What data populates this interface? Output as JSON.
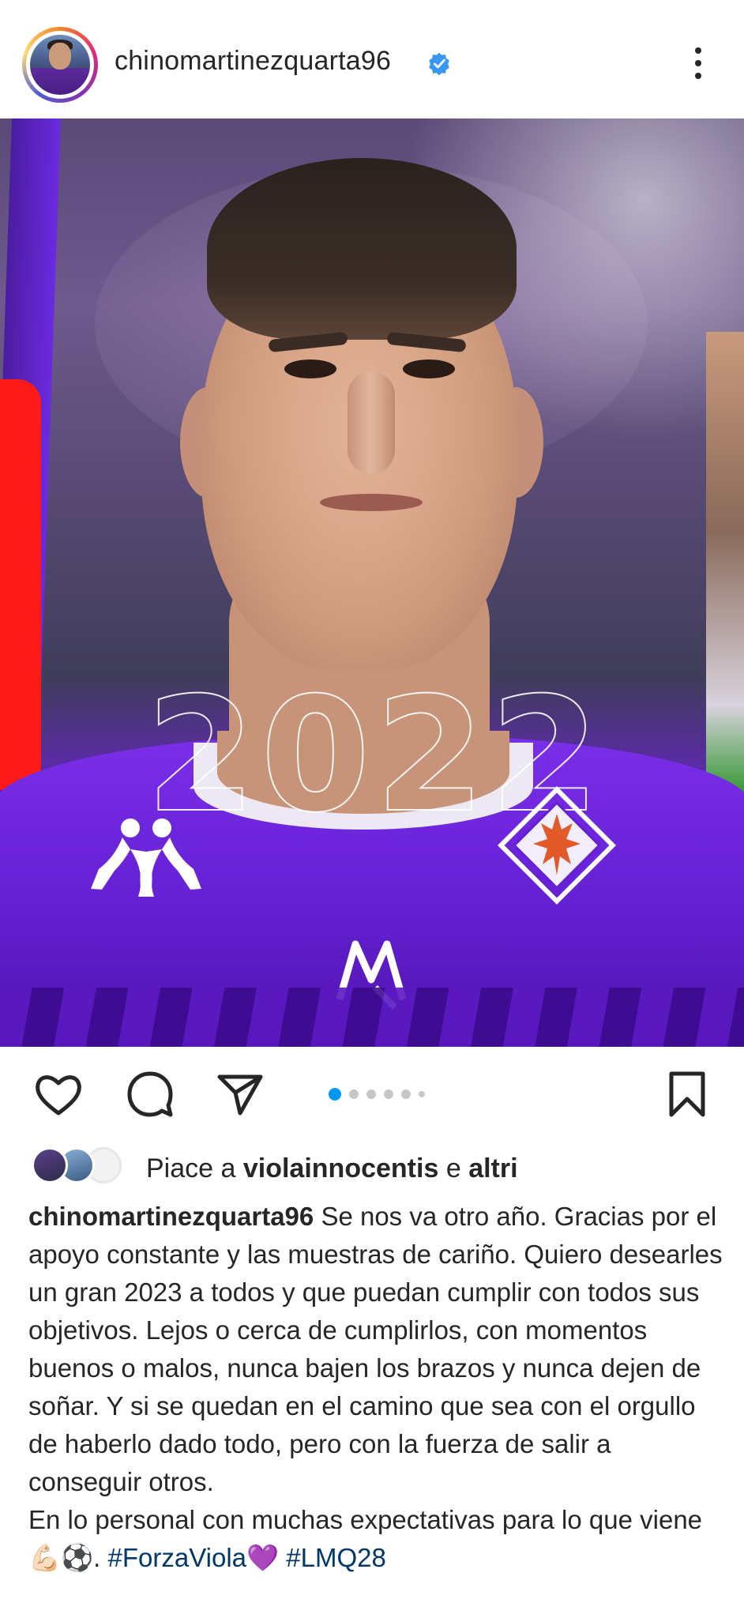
{
  "header": {
    "username": "chinomartinezquarta96",
    "verified": true
  },
  "post": {
    "image_text": "2022",
    "carousel": {
      "count": 6,
      "active_index": 0
    }
  },
  "actions": {
    "icons": [
      "heart-icon",
      "comment-icon",
      "share-icon",
      "bookmark-icon"
    ]
  },
  "likes": {
    "prefix": "Piace a",
    "liked_by": "violainnocentis",
    "joiner": "e",
    "others": "altri"
  },
  "caption": {
    "username": "chinomartinezquarta96",
    "text_1": "Se nos va otro año. Gracias por el apoyo constante y las muestras de cariño. Quiero desearles un gran 2023 a todos y que puedan cumplir con todos sus objetivos. Lejos o cerca de cumplirlos, con momentos buenos o malos, nunca bajen los brazos y nunca dejen de soñar. Y si se quedan en el camino que sea con el orgullo de haberlo dado todo, pero con la fuerza de salir a conseguir otros.",
    "text_2": "En lo personal con muchas expectativas para lo que viene💪🏻⚽.",
    "hashtag_1": "#ForzaViola",
    "emoji_heart": "💜",
    "hashtag_2": "#LMQ28"
  },
  "colors": {
    "accent_blue": "#0095f6",
    "verified_blue": "#3897f0",
    "hashtag": "#00376b",
    "fiorentina_purple": "#6520d4"
  }
}
